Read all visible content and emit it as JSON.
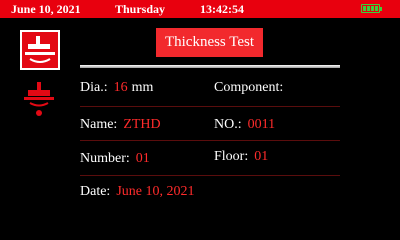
{
  "status": {
    "date": "June 10, 2021",
    "day": "Thursday",
    "time": "13:42:54",
    "battery_level": 1.0,
    "battery_color": "#3ad13a",
    "bar_color": "#e8000e"
  },
  "sidebar": {
    "icons": [
      "thickness-probe-icon",
      "probe-signal-icon"
    ]
  },
  "header": {
    "title": "Thickness Test"
  },
  "fields": {
    "dia_label": "Dia.:",
    "dia_value": "16",
    "dia_unit": "mm",
    "component_label": "Component:",
    "component_value": "",
    "name_label": "Name:",
    "name_value": "ZTHD",
    "no_label": "NO.:",
    "no_value": "0011",
    "number_label": "Number:",
    "number_value": "01",
    "floor_label": "Floor:",
    "floor_value": "01",
    "date_label": "Date:",
    "date_value": "June 10, 2021"
  }
}
